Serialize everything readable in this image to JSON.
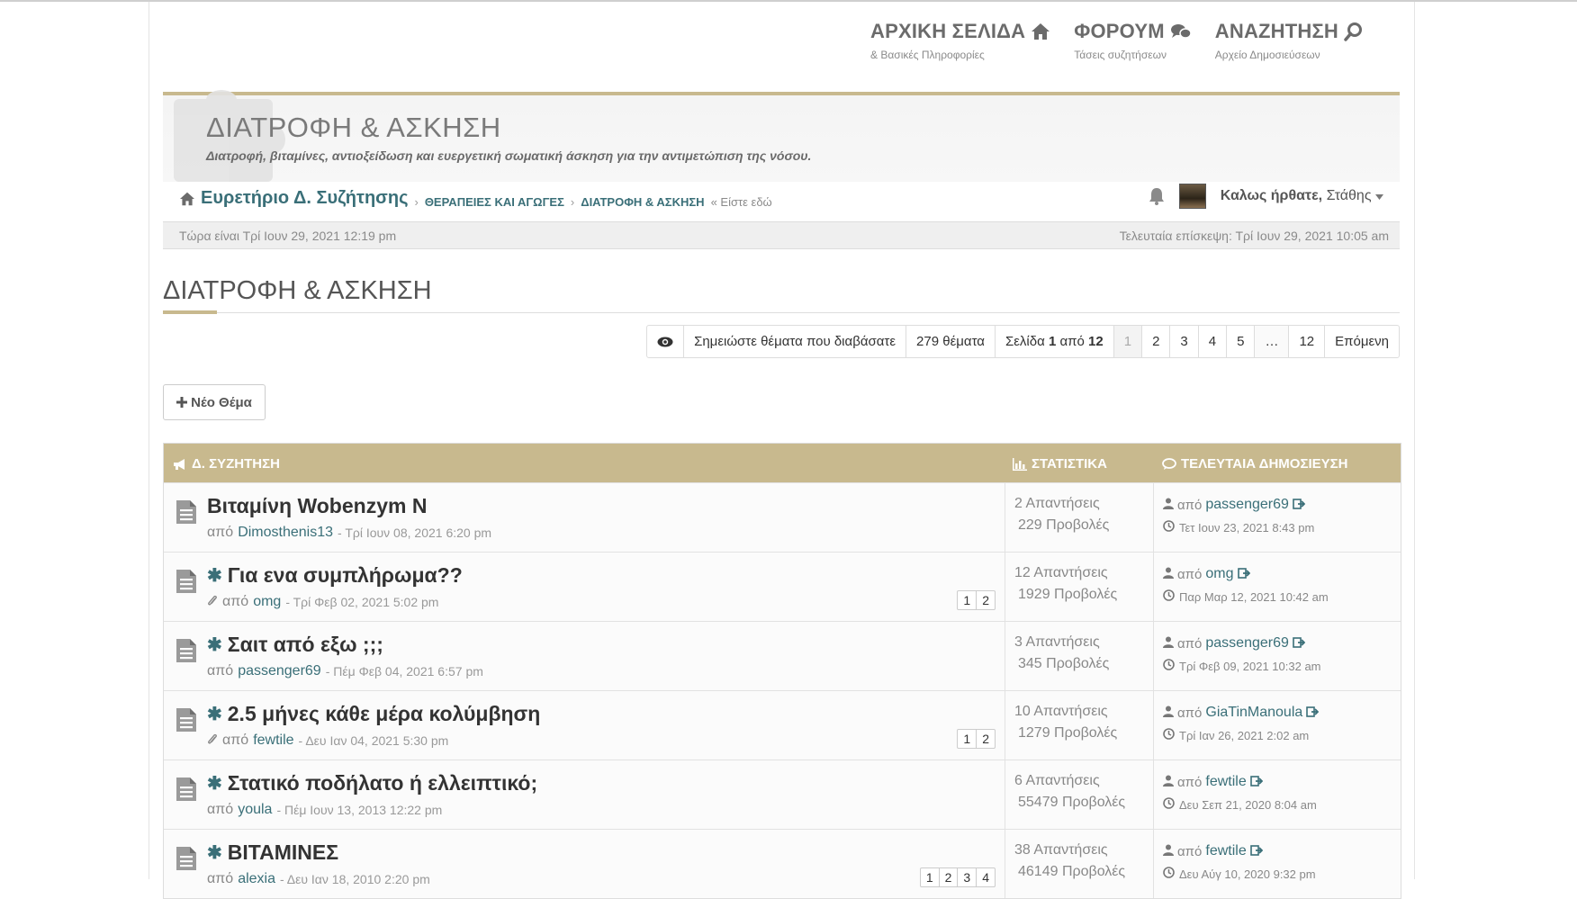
{
  "nav": [
    {
      "title": "ΑΡΧΙΚΗ ΣΕΛΙΔΑ",
      "sub": "& Βασικές Πληροφορίες",
      "icon": "home-icon"
    },
    {
      "title": "ΦΟΡΟΥΜ",
      "sub": "Τάσεις συζητήσεων",
      "icon": "chat-bubbles-icon"
    },
    {
      "title": "ΑΝΑΖΗΤΗΣΗ",
      "sub": "Αρχείο Δημοσιεύσεων",
      "icon": "search-icon"
    }
  ],
  "banner": {
    "title": "ΔΙΑΤΡΟΦΗ & ΑΣΚΗΣΗ",
    "description": "Διατροφή, βιταμίνες, αντιοξείδωση και ευεργετική σωματική άσκηση για την αντιμετώπιση της νόσου."
  },
  "breadcrumb": {
    "home": "Ευρετήριο Δ. Συζήτησης",
    "sep": "›",
    "items": [
      "ΘΕΡΑΠΕΙΕΣ ΚΑΙ ΑΓΩΓΕΣ",
      "ΔΙΑΤΡΟΦΗ & ΑΣΚΗΣΗ"
    ],
    "here": "« Είστε εδώ"
  },
  "user": {
    "welcome": "Καλως ήρθατε,",
    "name": "Στάθης"
  },
  "timebar": {
    "now": "Τώρα είναι Τρί Ιουν 29, 2021 12:19 pm",
    "last_visit": "Τελευταία επίσκεψη: Τρί Ιουν 29, 2021 10:05 am"
  },
  "forum_title": "ΔΙΑΤΡΟΦΗ & ΑΣΚΗΣΗ",
  "pagination": {
    "mark_read": "Σημειώστε θέματα που διαβάσατε",
    "topics": "279 θέματα",
    "page_prefix": "Σελίδα",
    "page_current": "1",
    "page_of": "από",
    "page_total": "12",
    "pages": [
      "1",
      "2",
      "3",
      "4",
      "5",
      "…",
      "12"
    ],
    "next": "Επόμενη"
  },
  "new_topic": "Νέο Θέμα",
  "table": {
    "headers": {
      "topics": "Δ. ΣΥΖΗΤΗΣΗ",
      "stats": "ΣΤΑΤΙΣΤΙΚΑ",
      "last": "ΤΕΛΕΥΤΑΙΑ ΔΗΜΟΣΙΕΥΣΗ"
    },
    "rows": [
      {
        "title": "Βιταμίνη Wobenzym N",
        "sticky": false,
        "attach": false,
        "by": "από",
        "author": "Dimosthenis13",
        "date": "- Τρί Ιουν 08, 2021 6:20 pm",
        "pages": [],
        "replies": "2 Απαντήσεις",
        "views": "229 Προβολές",
        "last_by": "από",
        "last_user": "passenger69",
        "last_date": "Τετ Ιουν 23, 2021 8:43 pm"
      },
      {
        "title": "Για ενα συμπλήρωμα??",
        "sticky": true,
        "attach": true,
        "by": "από",
        "author": "omg",
        "date": "- Τρί Φεβ 02, 2021 5:02 pm",
        "pages": [
          "1",
          "2"
        ],
        "replies": "12 Απαντήσεις",
        "views": "1929 Προβολές",
        "last_by": "από",
        "last_user": "omg",
        "last_date": "Παρ Μαρ 12, 2021 10:42 am"
      },
      {
        "title": "Σαιτ από εξω ;;;",
        "sticky": true,
        "attach": false,
        "by": "από",
        "author": "passenger69",
        "date": "- Πέμ Φεβ 04, 2021 6:57 pm",
        "pages": [],
        "replies": "3 Απαντήσεις",
        "views": "345 Προβολές",
        "last_by": "από",
        "last_user": "passenger69",
        "last_date": "Τρί Φεβ 09, 2021 10:32 am"
      },
      {
        "title": "2.5 μήνες κάθε μέρα κολύμβηση",
        "sticky": true,
        "attach": true,
        "by": "από",
        "author": "fewtile",
        "date": "- Δευ Ιαν 04, 2021 5:30 pm",
        "pages": [
          "1",
          "2"
        ],
        "replies": "10 Απαντήσεις",
        "views": "1279 Προβολές",
        "last_by": "από",
        "last_user": "GiaTinManoula",
        "last_date": "Τρί Ιαν 26, 2021 2:02 am"
      },
      {
        "title": "Στατικό ποδήλατο ή ελλειπτικό;",
        "sticky": true,
        "attach": false,
        "by": "από",
        "author": "youla",
        "date": "- Πέμ Ιουν 13, 2013 12:22 pm",
        "pages": [],
        "replies": "6 Απαντήσεις",
        "views": "55479 Προβολές",
        "last_by": "από",
        "last_user": "fewtile",
        "last_date": "Δευ Σεπ 21, 2020 8:04 am"
      },
      {
        "title": "ΒΙΤΑΜΙΝΕΣ",
        "sticky": true,
        "attach": false,
        "by": "από",
        "author": "alexia",
        "date": "- Δευ Ιαν 18, 2010 2:20 pm",
        "pages": [
          "1",
          "2",
          "3",
          "4"
        ],
        "replies": "38 Απαντήσεις",
        "views": "46149 Προβολές",
        "last_by": "από",
        "last_user": "fewtile",
        "last_date": "Δευ Αύγ 10, 2020 9:32 pm"
      }
    ]
  },
  "colors": {
    "accent": "#c8b98e",
    "link": "#3a6f78"
  }
}
